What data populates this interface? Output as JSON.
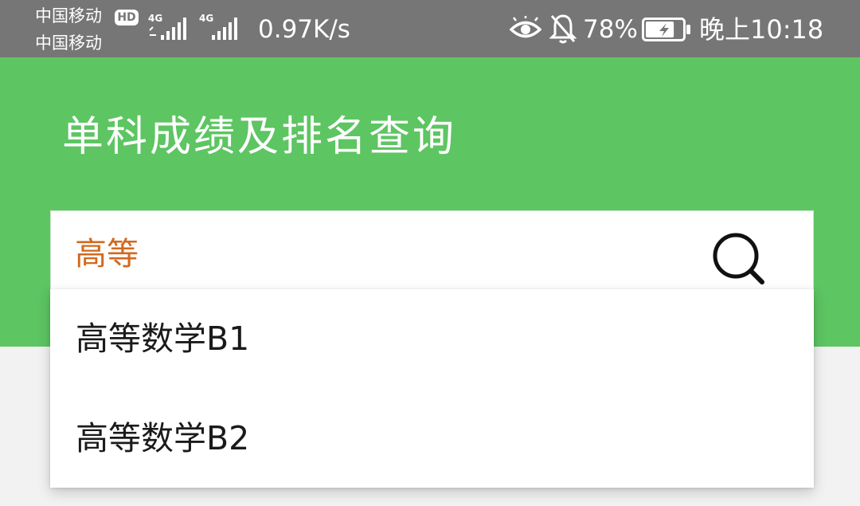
{
  "status_bar": {
    "carrier_1": "中国移动",
    "carrier_2": "中国移动",
    "hd_badge": "HD",
    "signal_1_label": "4G",
    "signal_2_label": "4G",
    "net_speed": "0.97K/s",
    "battery_percent": "78%",
    "battery_level": 0.78,
    "time": "晚上10:18",
    "icons": [
      "eye-icon",
      "bell-off-icon",
      "battery-charging-icon"
    ]
  },
  "header": {
    "title": "单科成绩及排名查询",
    "background_color": "#5dc562"
  },
  "search": {
    "value": "高等",
    "value_color": "#d2691e",
    "icon": "search-icon"
  },
  "suggestions": [
    {
      "label": "高等数学B1"
    },
    {
      "label": "高等数学B2"
    }
  ]
}
